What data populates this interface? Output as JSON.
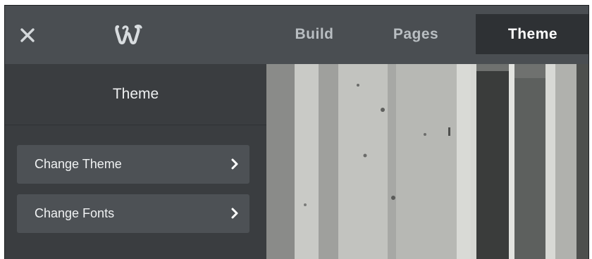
{
  "topbar": {
    "close_icon": "close-icon",
    "logo_icon": "weebly-logo-icon",
    "tabs": [
      {
        "label": "Build",
        "active": false
      },
      {
        "label": "Pages",
        "active": false
      },
      {
        "label": "Theme",
        "active": true
      }
    ]
  },
  "sidebar": {
    "title": "Theme",
    "items": [
      {
        "label": "Change Theme",
        "icon": "chevron-right-icon"
      },
      {
        "label": "Change Fonts",
        "icon": "chevron-right-icon"
      }
    ]
  },
  "preview": {
    "description_icon": "photo-preview"
  },
  "colors": {
    "topbar": "#4a4e52",
    "active_tab": "#2e3134",
    "sidebar": "#3a3d40",
    "menu_item": "#4d5155"
  }
}
